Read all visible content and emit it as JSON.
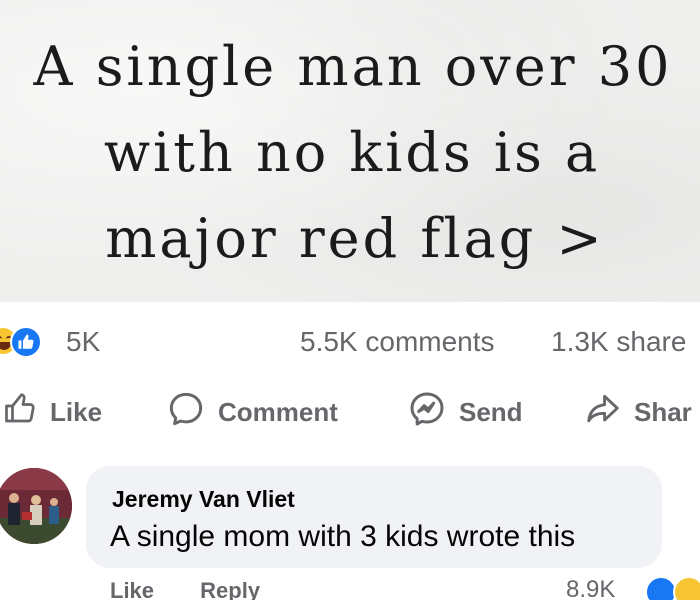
{
  "post_image": {
    "lines": [
      "A single man over 30",
      "with no kids is a",
      "major red flag >"
    ]
  },
  "stats": {
    "reaction_count": "5K",
    "comments": "5.5K comments",
    "shares": "1.3K share"
  },
  "actions": {
    "like": "Like",
    "comment": "Comment",
    "send": "Send",
    "share": "Shar"
  },
  "comment": {
    "author": "Jeremy Van Vliet",
    "text": "A single mom with 3 kids wrote this",
    "like": "Like",
    "reply": "Reply",
    "reaction_count": "8.9K"
  },
  "colors": {
    "accent": "#1877f2",
    "haha": "#f7c531",
    "muted_text": "#65676b",
    "bubble": "#f0f2f5"
  }
}
